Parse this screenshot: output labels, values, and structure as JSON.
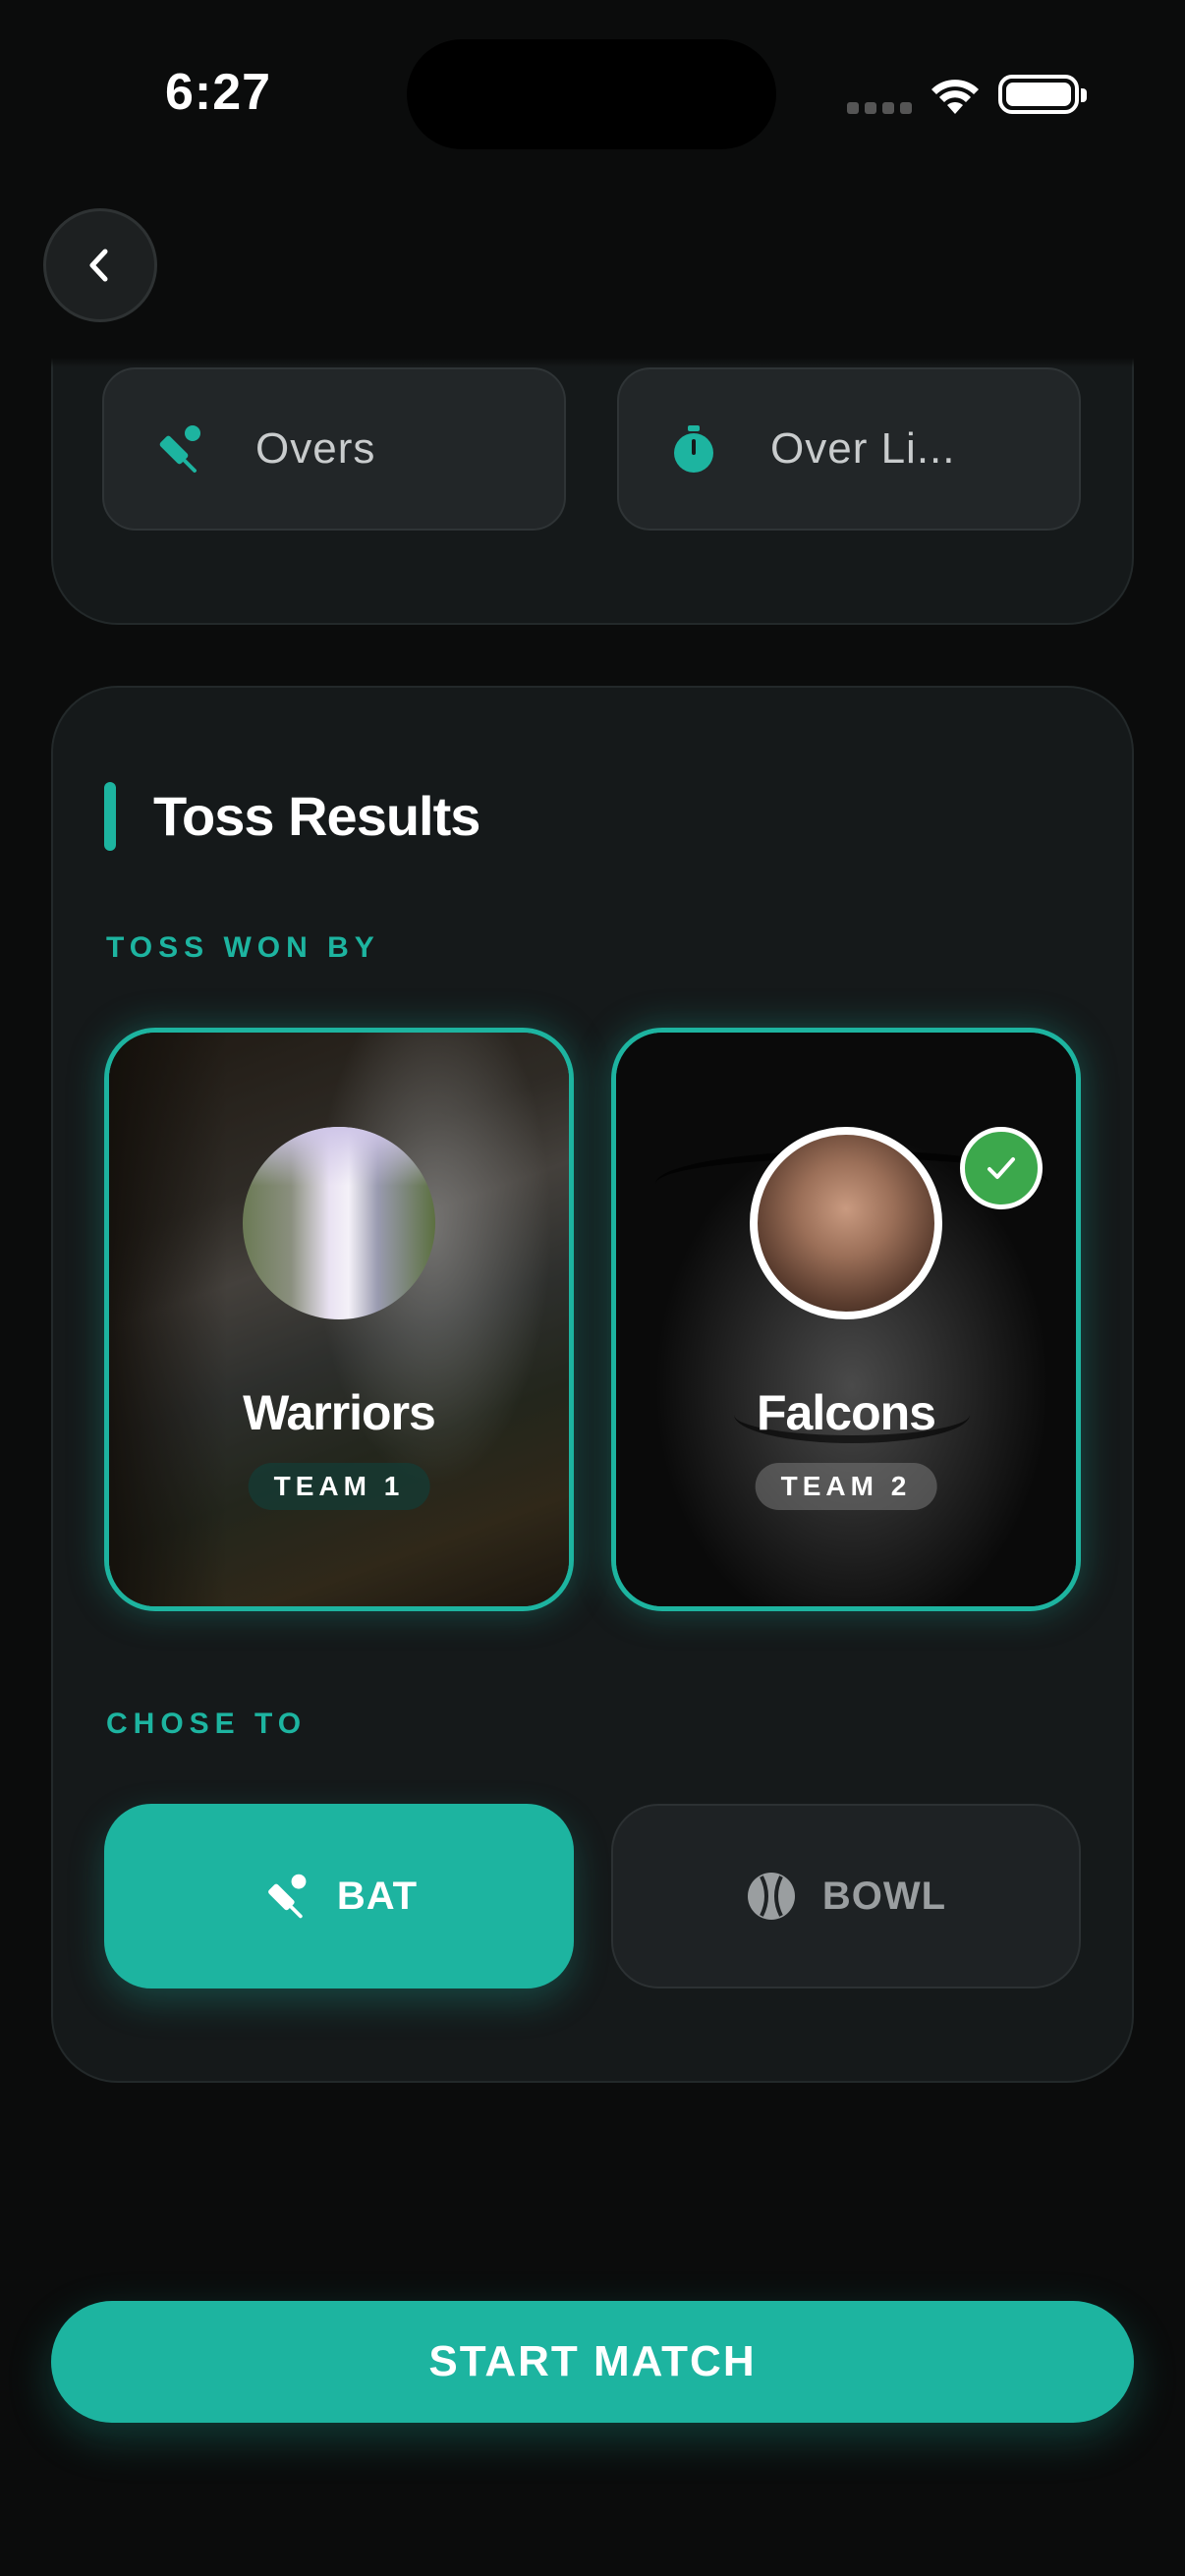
{
  "status_bar": {
    "time": "6:27"
  },
  "match_settings": {
    "overs_label": "Overs",
    "over_limit_label": "Over Li..."
  },
  "toss": {
    "title": "Toss Results",
    "won_by_label": "TOSS WON BY",
    "teams": [
      {
        "name": "Warriors",
        "tag": "TEAM 1",
        "selected": false
      },
      {
        "name": "Falcons",
        "tag": "TEAM 2",
        "selected": true
      }
    ],
    "chose_to_label": "CHOSE TO",
    "choices": [
      {
        "label": "BAT",
        "selected": true
      },
      {
        "label": "BOWL",
        "selected": false
      }
    ]
  },
  "start_button": {
    "label": "START MATCH"
  },
  "colors": {
    "accent": "#1db4a0",
    "background": "#0b0c0c",
    "card": "#15191a",
    "check": "#3ca84c"
  },
  "icons": [
    "back-chevron-icon",
    "cricket-bat-icon",
    "stopwatch-icon",
    "checkmark-icon",
    "cricket-ball-icon",
    "wifi-icon",
    "battery-icon"
  ]
}
